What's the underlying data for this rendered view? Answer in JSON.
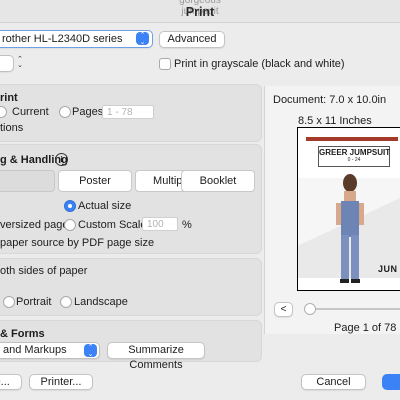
{
  "window": {
    "title": "Print",
    "title_cut": "gorgeous jumpsuit"
  },
  "printer": {
    "label": "rother HL-L2340D series",
    "advanced_label": "Advanced"
  },
  "copies": {
    "value": "",
    "grayscale_label": "Print in grayscale (black and white)"
  },
  "pages": {
    "header": "rint",
    "current_label": "Current",
    "pages_label": "Pages",
    "range_placeholder": "1 - 78",
    "options_label": "tions"
  },
  "sizing": {
    "header": "g & Handling",
    "tabs": [
      "",
      "Poster",
      "Multiple",
      "Booklet"
    ],
    "actual_size_label": "Actual size",
    "oversized_label": "versized pages",
    "custom_scale_label": "Custom Scale:",
    "custom_scale_placeholder": "100",
    "percent_label": "%",
    "paper_source_label": "paper source by PDF page size"
  },
  "duplex": {
    "label": "oth sides of paper"
  },
  "orientation": {
    "portrait_label": "Portrait",
    "landscape_label": "Landscape"
  },
  "forms": {
    "header": "& Forms",
    "select_value": "and Markups",
    "summarize_label": "Summarize Comments"
  },
  "preview": {
    "document_size": "Document: 7.0 x 10.0in",
    "paper_size": "8.5 x 11 Inches",
    "page_title": "GREER JUMPSUIT",
    "page_subtitle": "0 - 24",
    "brand": "JUN",
    "prev_label": "<",
    "page_count": "Page 1 of 78"
  },
  "footer": {
    "left_button": "O...",
    "printer_button": "Printer...",
    "cancel_label": "Cancel"
  },
  "colors": {
    "accent": "#3b82f6",
    "header_bar": "#a33a2a"
  }
}
